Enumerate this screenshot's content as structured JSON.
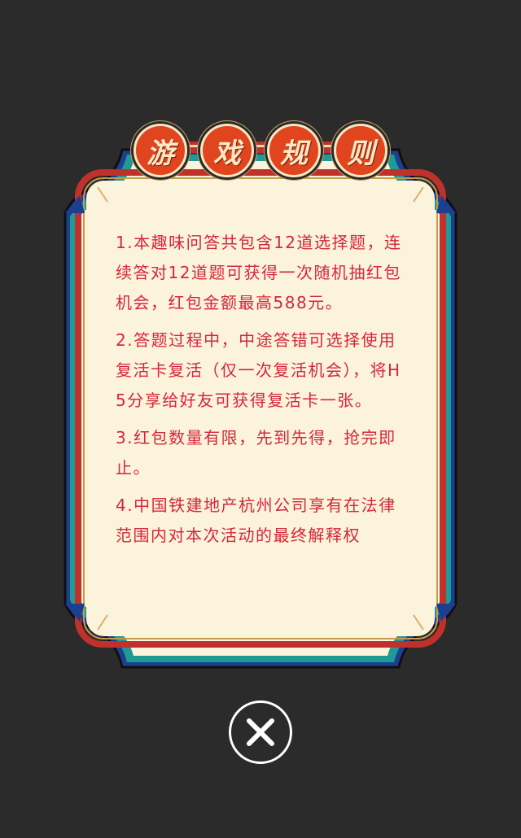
{
  "dialog": {
    "title_chars": [
      "游",
      "戏",
      "规",
      "则"
    ],
    "rules": [
      "1.本趣味问答共包含12道选择题，连续答对12道题可获得一次随机抽红包机会，红包金额最高588元。",
      "2.答题过程中，中途答错可选择使用复活卡复活（仅一次复活机会），将H5分享给好友可获得复活卡一张。",
      "3.红包数量有限，先到先得，抢完即止。",
      "4.中国铁建地产杭州公司享有在法律范围内对本次活动的最终解释权"
    ]
  },
  "close_button": {
    "icon": "close-icon"
  },
  "colors": {
    "background": "#2b2b2b",
    "panel": "#fbf3dc",
    "red_border": "#c0312b",
    "teal_border": "#1f9a94",
    "blue_border": "#1d3f8f",
    "rule_text": "#d6263b",
    "title_disc": "#e0451f"
  }
}
